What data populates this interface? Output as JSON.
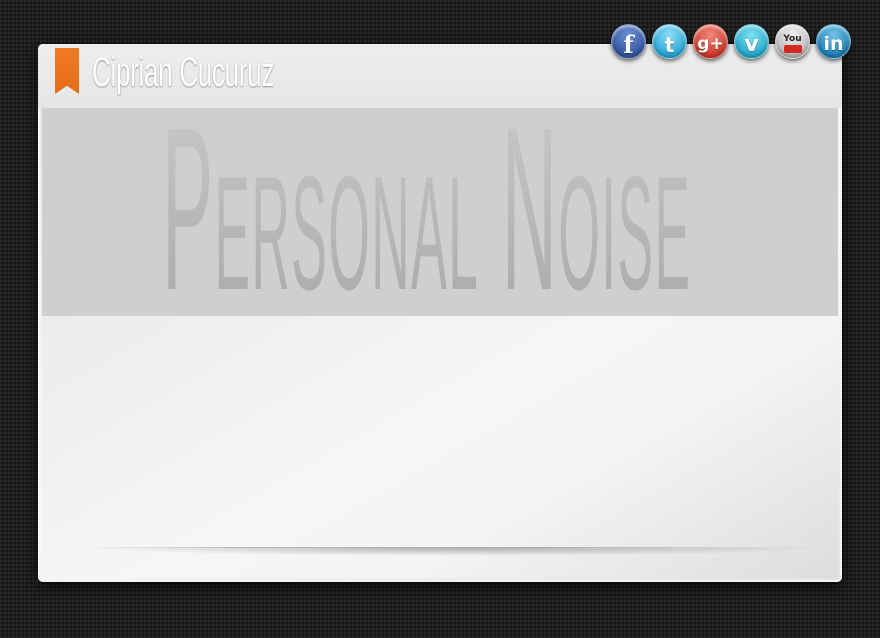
{
  "header": {
    "site_name": "Ciprian Cucuruz"
  },
  "hero": {
    "title": "Personal Noise"
  },
  "social": {
    "items": [
      {
        "name": "facebook",
        "icon": "facebook-icon",
        "glyph": "f",
        "color": "#3b5998"
      },
      {
        "name": "twitter",
        "icon": "twitter-icon",
        "glyph": "t",
        "color": "#2ba6d6"
      },
      {
        "name": "google-plus",
        "icon": "google-plus-icon",
        "glyph": "g+",
        "color": "#cc3a2c"
      },
      {
        "name": "vimeo",
        "icon": "vimeo-icon",
        "glyph": "v",
        "color": "#27a9c9"
      },
      {
        "name": "youtube",
        "icon": "youtube-icon",
        "glyph": "You",
        "color": "#d12b22"
      },
      {
        "name": "linkedin",
        "icon": "linkedin-icon",
        "glyph": "in",
        "color": "#1f7fb3"
      }
    ]
  },
  "colors": {
    "accent": "#e8711a",
    "background": "#1f1f1f",
    "hero_band": "#cfcfcf",
    "card": "#f4f4f4"
  }
}
